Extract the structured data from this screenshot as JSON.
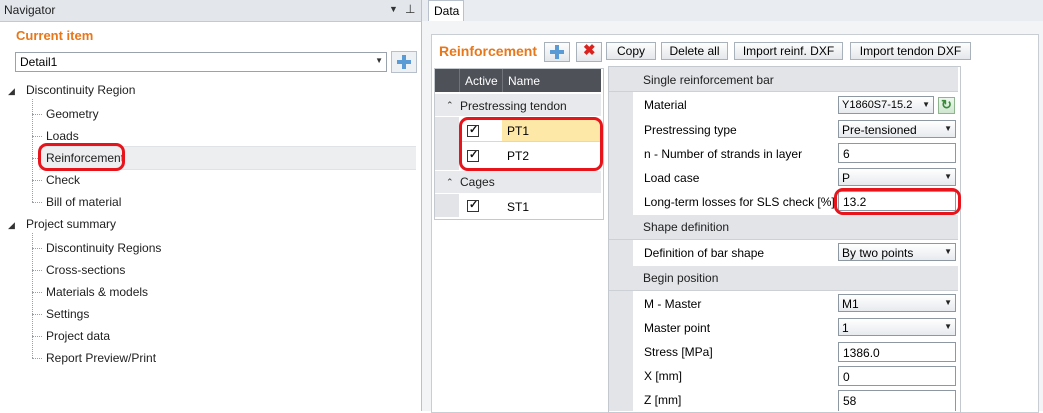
{
  "navigator": {
    "title": "Navigator",
    "current_item_label": "Current item",
    "detail_select_value": "Detail1",
    "tree": {
      "discontinuity_region": {
        "label": "Discontinuity Region",
        "children": [
          "Geometry",
          "Loads",
          "Reinforcement",
          "Check",
          "Bill of material"
        ]
      },
      "project_summary": {
        "label": "Project summary",
        "children": [
          "Discontinuity Regions",
          "Cross-sections",
          "Materials & models",
          "Settings",
          "Project data",
          "Report Preview/Print"
        ]
      }
    },
    "selected_item": "Reinforcement"
  },
  "data_tab": {
    "label": "Data"
  },
  "toolbar": {
    "title": "Reinforcement",
    "copy_label": "Copy",
    "delete_all_label": "Delete all",
    "import_reinf_label": "Import reinf. DXF",
    "import_tendon_label": "Import tendon DXF"
  },
  "table": {
    "headers": {
      "active": "Active",
      "name": "Name"
    },
    "groups": [
      {
        "label": "Prestressing tendon",
        "rows": [
          {
            "name": "PT1",
            "checked": true,
            "selected": true
          },
          {
            "name": "PT2",
            "checked": true,
            "selected": false
          }
        ]
      },
      {
        "label": "Cages",
        "rows": [
          {
            "name": "ST1",
            "checked": true,
            "selected": false
          }
        ]
      }
    ]
  },
  "properties": {
    "section1": "Single reinforcement bar",
    "material": {
      "label": "Material",
      "value": "Y1860S7-15.2"
    },
    "prestressing_type": {
      "label": "Prestressing type",
      "value": "Pre-tensioned"
    },
    "strands": {
      "label": "n - Number of strands in layer",
      "value": "6"
    },
    "load_case": {
      "label": "Load case",
      "value": "P"
    },
    "losses": {
      "label": "Long-term losses for SLS check [%]",
      "value": "13.2"
    },
    "section2": "Shape definition",
    "bar_shape": {
      "label": "Definition of bar shape",
      "value": "By two points"
    },
    "section3": "Begin position",
    "master": {
      "label": "M - Master",
      "value": "M1"
    },
    "master_point": {
      "label": "Master point",
      "value": "1"
    },
    "stress": {
      "label": "Stress [MPa]",
      "value": "1386.0"
    },
    "x": {
      "label": "X [mm]",
      "value": "0"
    },
    "z": {
      "label": "Z [mm]",
      "value": "58"
    }
  },
  "colors": {
    "accent": "#e8771a",
    "highlight": "#e8141c",
    "header_dark": "#4e5158",
    "selected_row": "#fde8a8"
  },
  "icons": {
    "add": "plus-icon",
    "delete": "x-icon",
    "refresh": "refresh-icon",
    "pin": "pin-icon"
  }
}
